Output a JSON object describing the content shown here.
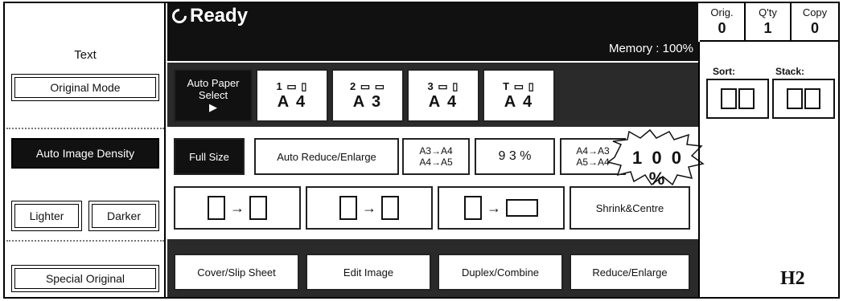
{
  "left": {
    "text_label": "Text",
    "original_mode": "Original Mode",
    "auto_image_density": "Auto Image Density",
    "lighter": "Lighter",
    "darker": "Darker",
    "special_original": "Special Original"
  },
  "header": {
    "status": "Ready",
    "memory": "Memory : 100%"
  },
  "counters": [
    {
      "label": "Orig.",
      "value": "0"
    },
    {
      "label": "Q'ty",
      "value": "1"
    },
    {
      "label": "Copy",
      "value": "0"
    }
  ],
  "paper": {
    "auto_select": "Auto Paper Select",
    "auto_select_arrow": "▶",
    "trays": [
      {
        "tray": "1",
        "size": "A 4"
      },
      {
        "tray": "2",
        "size": "A 3"
      },
      {
        "tray": "3",
        "size": "A 4"
      },
      {
        "tray": "T",
        "size": "A 4"
      }
    ]
  },
  "reduce": {
    "full_size": "Full Size",
    "auto_reduce_enlarge": "Auto Reduce/Enlarge",
    "a3_a4": "A3→A4\nA4→A5",
    "pct93": "9 3 %",
    "a4_a3": "A4→A3\nA5→A4",
    "pct100": "1 0 0 %"
  },
  "duplex": {
    "shrink_centre": "Shrink&Centre"
  },
  "bottom": {
    "cover_slip": "Cover/Slip Sheet",
    "edit_image": "Edit Image",
    "duplex_combine": "Duplex/Combine",
    "reduce_enlarge": "Reduce/Enlarge"
  },
  "right": {
    "sort": "Sort:",
    "stack": "Stack:",
    "code": "H2"
  }
}
